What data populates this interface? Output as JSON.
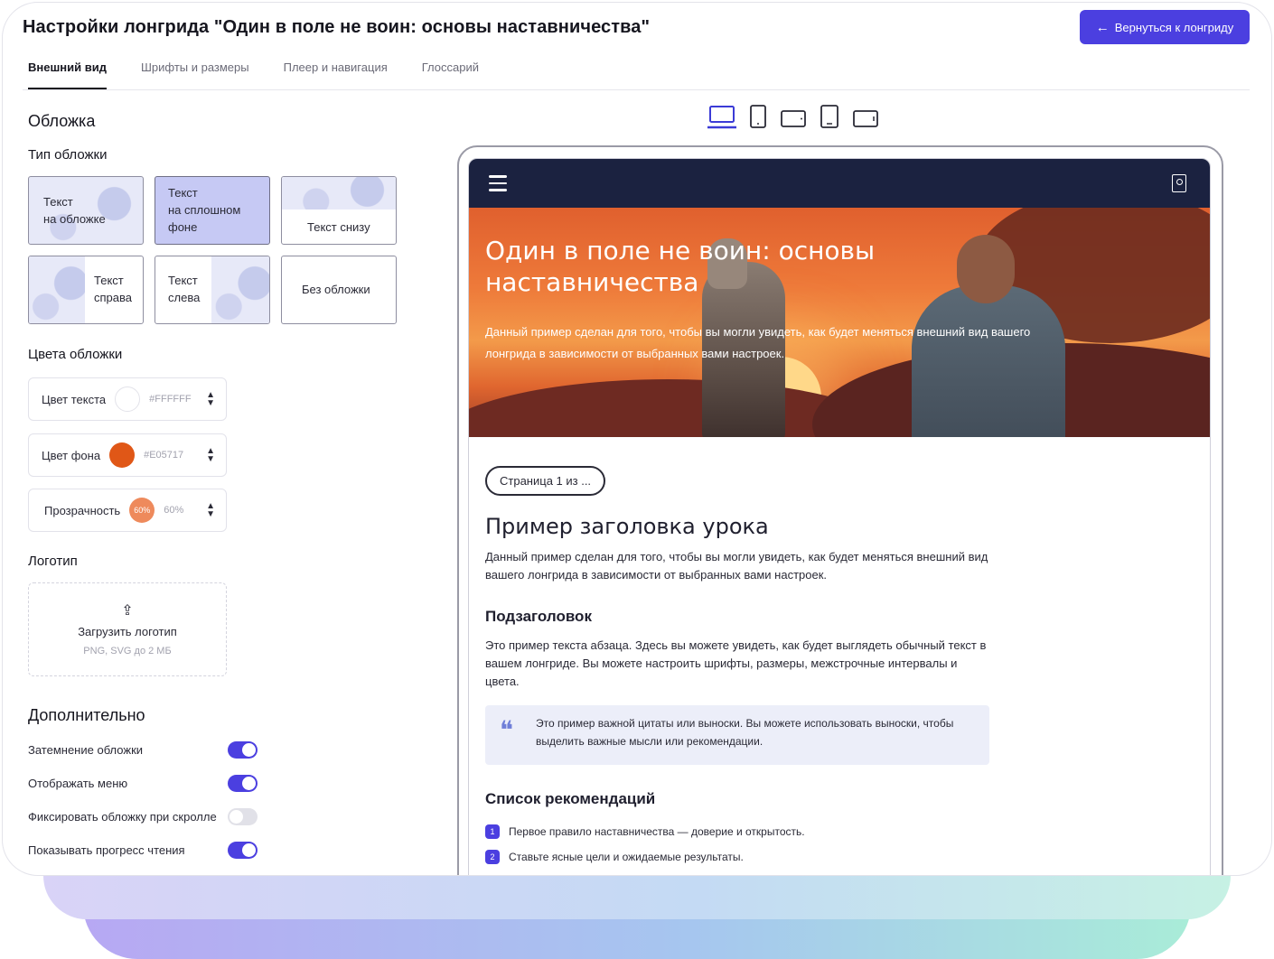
{
  "header": {
    "title": "Настройки лонгрида \"Один в поле не воин: основы наставничества\"",
    "back_button": "Вернуться к лонгриду"
  },
  "tabs": [
    {
      "label": "Внешний вид",
      "active": true
    },
    {
      "label": "Шрифты и размеры",
      "active": false
    },
    {
      "label": "Плеер и навигация",
      "active": false
    },
    {
      "label": "Глоссарий",
      "active": false
    }
  ],
  "cover": {
    "section_title": "Обложка",
    "type_title": "Тип обложки",
    "types": [
      {
        "line1": "Текст",
        "line2": "на обложке",
        "selected": false
      },
      {
        "line1": "Текст",
        "line2": "на сплошном",
        "line3": "фоне",
        "selected": true
      },
      {
        "line1": "Текст снизу",
        "selected": false
      },
      {
        "line1": "Текст",
        "line2": "справа",
        "selected": false
      },
      {
        "line1": "Текст",
        "line2": "слева",
        "selected": false
      },
      {
        "line1": "Без обложки",
        "selected": false
      }
    ],
    "colors_title": "Цвета обложки",
    "text_color": {
      "label": "Цвет текста",
      "hex": "#FFFFFF"
    },
    "bg_color": {
      "label": "Цвет фона",
      "hex": "#E05717"
    },
    "opacity": {
      "label": "Прозрачность",
      "badge": "60%",
      "value": "60%"
    }
  },
  "logo": {
    "title": "Логотип",
    "upload_label": "Загрузить логотип",
    "upload_hint": "PNG, SVG до 2 МБ"
  },
  "extra": {
    "title": "Дополнительно",
    "options": [
      {
        "label": "Затемнение обложки",
        "on": true
      },
      {
        "label": "Отображать меню",
        "on": true
      },
      {
        "label": "Фиксировать обложку при скролле",
        "on": false
      },
      {
        "label": "Показывать прогресс чтения",
        "on": true
      }
    ]
  },
  "devices": [
    "laptop-icon",
    "tablet-portrait-icon",
    "tablet-landscape-icon",
    "phone-portrait-icon",
    "phone-landscape-icon"
  ],
  "preview": {
    "hero_title": "Один в поле не воин: основы наставничества",
    "hero_subtitle": "Данный пример сделан для того, чтобы вы могли увидеть, как будет меняться внешний вид вашего лонгрида в зависимости от выбранных вами настроек.",
    "page_pill": "Страница 1 из ...",
    "lesson_title": "Пример заголовка урока",
    "lesson_text": "Данный пример сделан для того, чтобы вы могли увидеть, как будет меняться внешний вид вашего лонгрида в зависимости от выбранных вами настроек.",
    "subheading": "Подзаголовок",
    "paragraph": "Это пример текста абзаца. Здесь вы можете увидеть, как будет выглядеть обычный текст в вашем лонгриде. Вы можете настроить шрифты, размеры, межстрочные интервалы и цвета.",
    "quote": "Это пример важной цитаты или выноски. Вы можете использовать выноски, чтобы выделить важные мысли или рекомендации.",
    "list_title": "Список рекомендаций",
    "list": [
      {
        "num": "1",
        "text": "Первое правило наставничества — доверие и открытость."
      },
      {
        "num": "2",
        "text": "Ставьте ясные цели и ожидаемые результаты."
      }
    ]
  },
  "colors": {
    "accent": "#4B3FE0",
    "nav_dark": "#1B2240",
    "cover_bg": "#E05717"
  }
}
